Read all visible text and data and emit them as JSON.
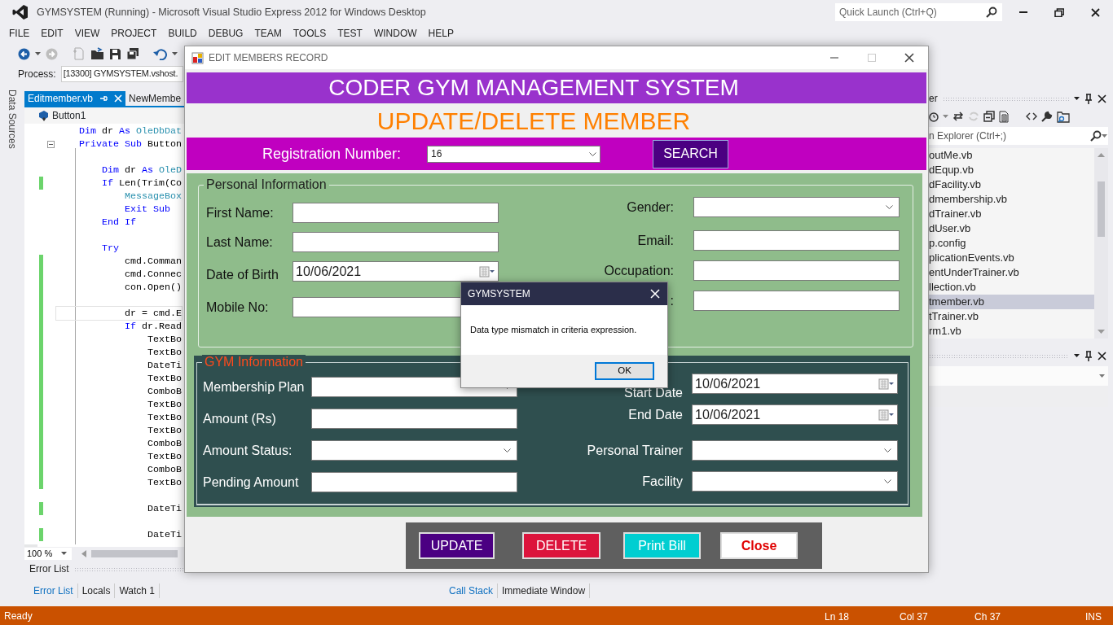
{
  "ide": {
    "title": "GYMSYSTEM (Running) - Microsoft Visual Studio Express 2012 for Windows Desktop",
    "quick_launch": {
      "placeholder": "Quick Launch (Ctrl+Q)"
    },
    "menu": [
      "FILE",
      "EDIT",
      "VIEW",
      "PROJECT",
      "BUILD",
      "DEBUG",
      "TEAM",
      "TOOLS",
      "TEST",
      "WINDOW",
      "HELP"
    ],
    "process": {
      "label": "Process:",
      "value": "[13300] GYMSYSTEM.vshost."
    },
    "side_tab": "Data Sources",
    "editor": {
      "tabs": [
        {
          "label": "Editmember.vb",
          "selected": true
        },
        {
          "label": "NewMembe",
          "selected": false
        }
      ],
      "member": "Button1",
      "zoom": "100 %",
      "lines": [
        {
          "changed": false,
          "tokens": [
            {
              "kind": "kw",
              "text": "    Dim"
            },
            {
              "kind": "plain",
              "text": " dr "
            },
            {
              "kind": "kw",
              "text": "As"
            },
            {
              "kind": "type",
              "text": " OleDbDat"
            }
          ]
        },
        {
          "changed": false,
          "foldable": true,
          "tokens": [
            {
              "kind": "kw",
              "text": "    Private Sub"
            },
            {
              "kind": "plain",
              "text": " Button"
            }
          ]
        },
        {
          "changed": false
        },
        {
          "changed": false,
          "tokens": [
            {
              "kind": "kw",
              "text": "        Dim"
            },
            {
              "kind": "plain",
              "text": " dr "
            },
            {
              "kind": "kw",
              "text": "As"
            },
            {
              "kind": "type",
              "text": " OleD"
            }
          ]
        },
        {
          "changed": true,
          "tokens": [
            {
              "kind": "kw",
              "text": "        If"
            },
            {
              "kind": "plain",
              "text": " Len(Trim(Co"
            }
          ]
        },
        {
          "changed": false,
          "tokens": [
            {
              "kind": "type",
              "text": "            MessageBox"
            }
          ]
        },
        {
          "changed": false,
          "tokens": [
            {
              "kind": "kw",
              "text": "            Exit Sub"
            }
          ]
        },
        {
          "changed": false,
          "tokens": [
            {
              "kind": "kw",
              "text": "        End If"
            }
          ]
        },
        {
          "changed": false
        },
        {
          "changed": false,
          "tokens": [
            {
              "kind": "kw",
              "text": "        Try"
            }
          ]
        },
        {
          "changed": true,
          "tokens": [
            {
              "kind": "plain",
              "text": "            cmd.Comman"
            }
          ]
        },
        {
          "changed": true,
          "tokens": [
            {
              "kind": "plain",
              "text": "            cmd.Connec"
            }
          ]
        },
        {
          "changed": true,
          "tokens": [
            {
              "kind": "plain",
              "text": "            con.Open()"
            }
          ]
        },
        {
          "changed": true
        },
        {
          "changed": true,
          "current": true,
          "tokens": [
            {
              "kind": "plain",
              "text": "            dr = cmd.E"
            }
          ]
        },
        {
          "changed": true,
          "tokens": [
            {
              "kind": "kw",
              "text": "            If"
            },
            {
              "kind": "plain",
              "text": " dr.Read"
            }
          ]
        },
        {
          "changed": true,
          "tokens": [
            {
              "kind": "plain",
              "text": "                TextBo"
            }
          ]
        },
        {
          "changed": true,
          "tokens": [
            {
              "kind": "plain",
              "text": "                TextBo"
            }
          ]
        },
        {
          "changed": true,
          "tokens": [
            {
              "kind": "plain",
              "text": "                DateTi"
            }
          ]
        },
        {
          "changed": true,
          "tokens": [
            {
              "kind": "plain",
              "text": "                TextBo"
            }
          ]
        },
        {
          "changed": true,
          "tokens": [
            {
              "kind": "plain",
              "text": "                ComboB"
            }
          ]
        },
        {
          "changed": true,
          "tokens": [
            {
              "kind": "plain",
              "text": "                TextBo"
            }
          ]
        },
        {
          "changed": true,
          "tokens": [
            {
              "kind": "plain",
              "text": "                TextBo"
            }
          ]
        },
        {
          "changed": true,
          "tokens": [
            {
              "kind": "plain",
              "text": "                TextBo"
            }
          ]
        },
        {
          "changed": true,
          "tokens": [
            {
              "kind": "plain",
              "text": "                ComboB"
            }
          ]
        },
        {
          "changed": true,
          "tokens": [
            {
              "kind": "plain",
              "text": "                TextBo"
            }
          ]
        },
        {
          "changed": true,
          "tokens": [
            {
              "kind": "plain",
              "text": "                ComboB"
            }
          ]
        },
        {
          "changed": true,
          "tokens": [
            {
              "kind": "plain",
              "text": "                TextBo"
            }
          ]
        },
        {
          "changed": false
        },
        {
          "changed": true,
          "tokens": [
            {
              "kind": "plain",
              "text": "                DateTi"
            }
          ]
        },
        {
          "changed": false
        },
        {
          "changed": true,
          "tokens": [
            {
              "kind": "plain",
              "text": "                DateTi"
            }
          ]
        }
      ]
    },
    "error_panel": {
      "title": "Error List",
      "tabs": [
        {
          "label": "Error List",
          "selected": true
        },
        {
          "label": "Locals",
          "selected": false
        },
        {
          "label": "Watch 1",
          "selected": false
        }
      ]
    },
    "debug_panel": {
      "tabs": [
        {
          "label": "Call Stack",
          "selected": true
        },
        {
          "label": "Immediate Window",
          "selected": false
        }
      ]
    },
    "solution_explorer": {
      "title": "er",
      "search": {
        "placeholder": "n Explorer (Ctrl+;)"
      },
      "files": [
        {
          "name": "outMe.vb",
          "selected": false
        },
        {
          "name": "dEqup.vb",
          "selected": false
        },
        {
          "name": "dFacility.vb",
          "selected": false
        },
        {
          "name": "dmembership.vb",
          "selected": false
        },
        {
          "name": "dTrainer.vb",
          "selected": false
        },
        {
          "name": "dUser.vb",
          "selected": false
        },
        {
          "name": "p.config",
          "selected": false
        },
        {
          "name": "plicationEvents.vb",
          "selected": false
        },
        {
          "name": "entUnderTrainer.vb",
          "selected": false
        },
        {
          "name": "llection.vb",
          "selected": false
        },
        {
          "name": "tmember.vb",
          "selected": true
        },
        {
          "name": "tTrainer.vb",
          "selected": false
        },
        {
          "name": "rm1.vb",
          "selected": false
        }
      ]
    },
    "status_bar": {
      "message": "Ready",
      "cells": [
        "Ln 18",
        "Col 37",
        "Ch 37",
        "INS"
      ]
    }
  },
  "form": {
    "title": "EDIT MEMBERS RECORD",
    "can_maximize": false,
    "banner": "CODER GYM MANAGEMENT SYSTEM",
    "heading": "UPDATE/DELETE MEMBER",
    "registration": {
      "label": "Registration Number:",
      "value": "16",
      "button": "SEARCH"
    },
    "personal": {
      "title": "Personal Information",
      "left": [
        {
          "label": "First Name:",
          "kind": "text"
        },
        {
          "label": "Last Name:",
          "kind": "text"
        },
        {
          "label": "Date of Birth",
          "kind": "date",
          "value": "10/06/2021"
        },
        {
          "label": "Mobile No:",
          "kind": "text"
        }
      ],
      "right": [
        {
          "label": "Gender:",
          "kind": "combo"
        },
        {
          "label": "Email:",
          "kind": "text"
        },
        {
          "label": "Occupation:",
          "kind": "text"
        },
        {
          "label": ":",
          "kind": "text"
        }
      ]
    },
    "gym": {
      "title": "GYM Information",
      "left": [
        {
          "label": "Membership Plan",
          "kind": "combo"
        },
        {
          "label": "Amount (Rs)",
          "kind": "text"
        },
        {
          "label": "Amount Status:",
          "kind": "combo"
        },
        {
          "label": "Pending Amount",
          "kind": "text"
        }
      ],
      "right": [
        {
          "label": "Start Date",
          "kind": "date",
          "value": "10/06/2021"
        },
        {
          "label": "End Date",
          "kind": "date",
          "value": "10/06/2021"
        },
        {
          "label": "Personal Trainer",
          "kind": "combo"
        },
        {
          "label": "Facility",
          "kind": "combo"
        }
      ]
    },
    "buttons": [
      {
        "label": "UPDATE",
        "kind": "update"
      },
      {
        "label": "DELETE",
        "kind": "delete"
      },
      {
        "label": "Print Bill",
        "kind": "print"
      },
      {
        "label": "Close",
        "kind": "close"
      }
    ]
  },
  "message_box": {
    "title": "GYMSYSTEM",
    "message": "Data type mismatch in criteria expression.",
    "button": "OK"
  }
}
